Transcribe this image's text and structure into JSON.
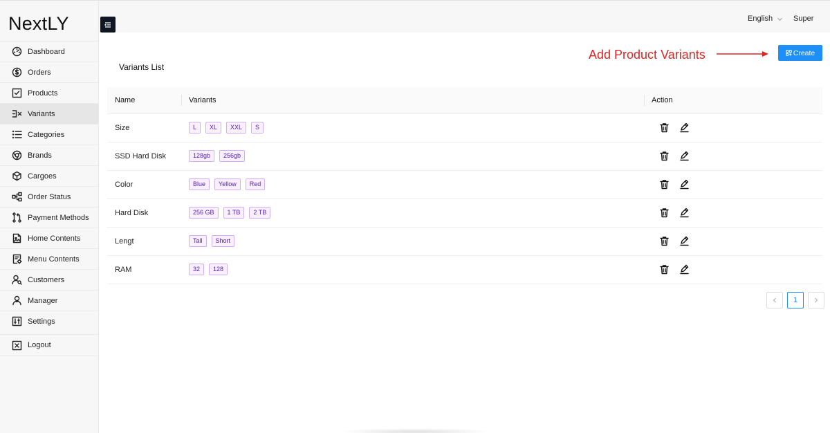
{
  "app": {
    "brand": "NextLY"
  },
  "sidebar": {
    "items": [
      {
        "label": "Dashboard",
        "icon": "gauge-icon",
        "active": false
      },
      {
        "label": "Orders",
        "icon": "dollar-circle-icon",
        "active": false
      },
      {
        "label": "Products",
        "icon": "check-square-icon",
        "active": false
      },
      {
        "label": "Variants",
        "icon": "variants-icon",
        "active": true
      },
      {
        "label": "Categories",
        "icon": "list-icon",
        "active": false
      },
      {
        "label": "Brands",
        "icon": "chrome-icon",
        "active": false
      },
      {
        "label": "Cargoes",
        "icon": "box-icon",
        "active": false
      },
      {
        "label": "Order Status",
        "icon": "workflow-icon",
        "active": false
      },
      {
        "label": "Payment Methods",
        "icon": "git-pull-icon",
        "active": false
      },
      {
        "label": "Home Contents",
        "icon": "file-image-icon",
        "active": false
      },
      {
        "label": "Menu Contents",
        "icon": "file-settings-icon",
        "active": false
      },
      {
        "label": "Customers",
        "icon": "user-search-icon",
        "active": false
      },
      {
        "label": "Manager",
        "icon": "user-icon",
        "active": false
      },
      {
        "label": "Settings",
        "icon": "sliders-icon",
        "active": false
      },
      {
        "label": "Logout",
        "icon": "x-square-icon",
        "active": false
      }
    ]
  },
  "header": {
    "language": "English",
    "user": "Super"
  },
  "annotation": {
    "text": "Add Product Variants",
    "color": "#e02424"
  },
  "toolbar": {
    "create_label": "Create",
    "accent": "#1d8ff7"
  },
  "list": {
    "title": "Variants List",
    "columns": [
      "Name",
      "Variants",
      "Action"
    ],
    "rows": [
      {
        "name": "Size",
        "variants": [
          "L",
          "XL",
          "XXL",
          "S"
        ]
      },
      {
        "name": "SSD Hard Disk",
        "variants": [
          "128gb",
          "256gb"
        ]
      },
      {
        "name": "Color",
        "variants": [
          "Blue",
          "Yellow",
          "Red"
        ]
      },
      {
        "name": "Hard Disk",
        "variants": [
          "256 GB",
          "1 TB",
          "2 TB"
        ]
      },
      {
        "name": "Lengt",
        "variants": [
          "Tall",
          "Short"
        ]
      },
      {
        "name": "RAM",
        "variants": [
          "32",
          "128"
        ]
      }
    ]
  },
  "pagination": {
    "current": "1"
  }
}
